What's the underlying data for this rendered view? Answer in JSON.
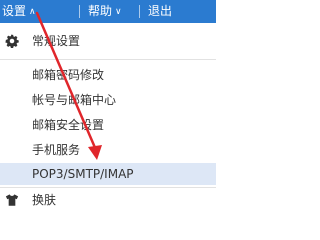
{
  "topbar": {
    "settings_label": "设置",
    "help_label": "帮助",
    "logout_label": "退出"
  },
  "menu": {
    "general_label": "常规设置",
    "items": [
      {
        "label": "邮箱密码修改"
      },
      {
        "label": "帐号与邮箱中心"
      },
      {
        "label": "邮箱安全设置"
      },
      {
        "label": "手机服务"
      },
      {
        "label": "POP3/SMTP/IMAP"
      }
    ],
    "skin_label": "换肤"
  },
  "colors": {
    "topbar_bg": "#2b7bd0",
    "highlight_bg": "#dde7f6",
    "annotation_arrow": "#e0262b"
  },
  "icons": {
    "general": "gear-icon",
    "skin": "tshirt-icon"
  }
}
